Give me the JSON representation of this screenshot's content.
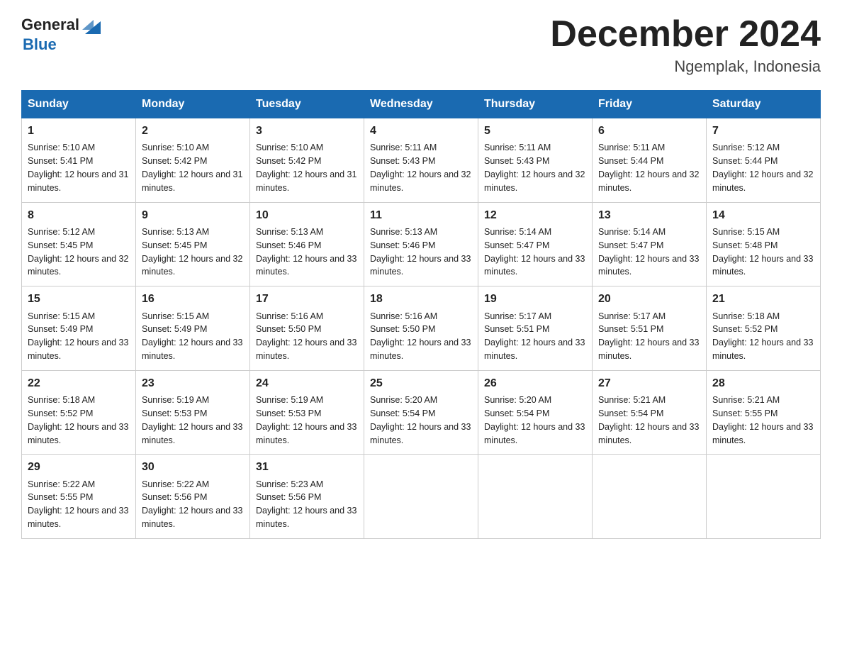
{
  "header": {
    "logo_general": "General",
    "logo_blue": "Blue",
    "month_title": "December 2024",
    "location": "Ngemplak, Indonesia"
  },
  "days_of_week": [
    "Sunday",
    "Monday",
    "Tuesday",
    "Wednesday",
    "Thursday",
    "Friday",
    "Saturday"
  ],
  "weeks": [
    [
      {
        "day": "1",
        "sunrise": "5:10 AM",
        "sunset": "5:41 PM",
        "daylight": "12 hours and 31 minutes."
      },
      {
        "day": "2",
        "sunrise": "5:10 AM",
        "sunset": "5:42 PM",
        "daylight": "12 hours and 31 minutes."
      },
      {
        "day": "3",
        "sunrise": "5:10 AM",
        "sunset": "5:42 PM",
        "daylight": "12 hours and 31 minutes."
      },
      {
        "day": "4",
        "sunrise": "5:11 AM",
        "sunset": "5:43 PM",
        "daylight": "12 hours and 32 minutes."
      },
      {
        "day": "5",
        "sunrise": "5:11 AM",
        "sunset": "5:43 PM",
        "daylight": "12 hours and 32 minutes."
      },
      {
        "day": "6",
        "sunrise": "5:11 AM",
        "sunset": "5:44 PM",
        "daylight": "12 hours and 32 minutes."
      },
      {
        "day": "7",
        "sunrise": "5:12 AM",
        "sunset": "5:44 PM",
        "daylight": "12 hours and 32 minutes."
      }
    ],
    [
      {
        "day": "8",
        "sunrise": "5:12 AM",
        "sunset": "5:45 PM",
        "daylight": "12 hours and 32 minutes."
      },
      {
        "day": "9",
        "sunrise": "5:13 AM",
        "sunset": "5:45 PM",
        "daylight": "12 hours and 32 minutes."
      },
      {
        "day": "10",
        "sunrise": "5:13 AM",
        "sunset": "5:46 PM",
        "daylight": "12 hours and 33 minutes."
      },
      {
        "day": "11",
        "sunrise": "5:13 AM",
        "sunset": "5:46 PM",
        "daylight": "12 hours and 33 minutes."
      },
      {
        "day": "12",
        "sunrise": "5:14 AM",
        "sunset": "5:47 PM",
        "daylight": "12 hours and 33 minutes."
      },
      {
        "day": "13",
        "sunrise": "5:14 AM",
        "sunset": "5:47 PM",
        "daylight": "12 hours and 33 minutes."
      },
      {
        "day": "14",
        "sunrise": "5:15 AM",
        "sunset": "5:48 PM",
        "daylight": "12 hours and 33 minutes."
      }
    ],
    [
      {
        "day": "15",
        "sunrise": "5:15 AM",
        "sunset": "5:49 PM",
        "daylight": "12 hours and 33 minutes."
      },
      {
        "day": "16",
        "sunrise": "5:15 AM",
        "sunset": "5:49 PM",
        "daylight": "12 hours and 33 minutes."
      },
      {
        "day": "17",
        "sunrise": "5:16 AM",
        "sunset": "5:50 PM",
        "daylight": "12 hours and 33 minutes."
      },
      {
        "day": "18",
        "sunrise": "5:16 AM",
        "sunset": "5:50 PM",
        "daylight": "12 hours and 33 minutes."
      },
      {
        "day": "19",
        "sunrise": "5:17 AM",
        "sunset": "5:51 PM",
        "daylight": "12 hours and 33 minutes."
      },
      {
        "day": "20",
        "sunrise": "5:17 AM",
        "sunset": "5:51 PM",
        "daylight": "12 hours and 33 minutes."
      },
      {
        "day": "21",
        "sunrise": "5:18 AM",
        "sunset": "5:52 PM",
        "daylight": "12 hours and 33 minutes."
      }
    ],
    [
      {
        "day": "22",
        "sunrise": "5:18 AM",
        "sunset": "5:52 PM",
        "daylight": "12 hours and 33 minutes."
      },
      {
        "day": "23",
        "sunrise": "5:19 AM",
        "sunset": "5:53 PM",
        "daylight": "12 hours and 33 minutes."
      },
      {
        "day": "24",
        "sunrise": "5:19 AM",
        "sunset": "5:53 PM",
        "daylight": "12 hours and 33 minutes."
      },
      {
        "day": "25",
        "sunrise": "5:20 AM",
        "sunset": "5:54 PM",
        "daylight": "12 hours and 33 minutes."
      },
      {
        "day": "26",
        "sunrise": "5:20 AM",
        "sunset": "5:54 PM",
        "daylight": "12 hours and 33 minutes."
      },
      {
        "day": "27",
        "sunrise": "5:21 AM",
        "sunset": "5:54 PM",
        "daylight": "12 hours and 33 minutes."
      },
      {
        "day": "28",
        "sunrise": "5:21 AM",
        "sunset": "5:55 PM",
        "daylight": "12 hours and 33 minutes."
      }
    ],
    [
      {
        "day": "29",
        "sunrise": "5:22 AM",
        "sunset": "5:55 PM",
        "daylight": "12 hours and 33 minutes."
      },
      {
        "day": "30",
        "sunrise": "5:22 AM",
        "sunset": "5:56 PM",
        "daylight": "12 hours and 33 minutes."
      },
      {
        "day": "31",
        "sunrise": "5:23 AM",
        "sunset": "5:56 PM",
        "daylight": "12 hours and 33 minutes."
      },
      null,
      null,
      null,
      null
    ]
  ]
}
